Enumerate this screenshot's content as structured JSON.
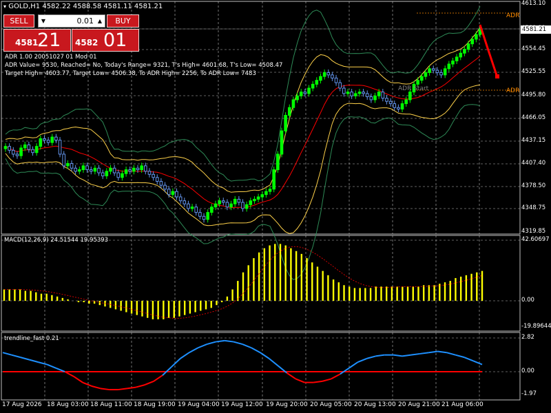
{
  "window": {
    "symbol_line": "GOLD,H1  4582.22 4588.58 4581.11 4581.21"
  },
  "trade_panel": {
    "sell_label": "SELL",
    "buy_label": "BUY",
    "lot": "0.01",
    "sell_price_small": "4581",
    "sell_price_big": "21",
    "buy_price_small": "4582",
    "buy_price_big": "01"
  },
  "adr": {
    "line1": "ADR 1.00 20051027 01 Mod 01",
    "line2": "ADR Value= 9530, Reached= No, Today's Range= 9321, T's High= 4601.68, T's Low= 4508.47",
    "line3": "Target High= 4603.77, Target Low= 4506.38, To ADR High= 2256, To ADR Low= 7483",
    "adr_label_top": "ADR",
    "adr_label_bottom": "ADR",
    "adr_start": "ADR Start"
  },
  "price_axis": {
    "ticks": [
      "4613.10",
      "4581.21",
      "4554.45",
      "4525.55",
      "4495.80",
      "4466.05",
      "4437.15",
      "4407.40",
      "4378.50",
      "4348.75",
      "4319.85"
    ],
    "current_price": "4581.21"
  },
  "macd": {
    "label": "MACD(12,26,9) 24.51544 19.95393",
    "ticks": [
      "42.60697",
      "0.00",
      "-19.89644"
    ]
  },
  "trendline": {
    "label": "trendline_fast 0.21",
    "ticks": [
      "2.82",
      "0.00",
      "-1.97"
    ]
  },
  "time_axis": {
    "labels": [
      "17 Aug 2026",
      "18 Aug 03:00",
      "18 Aug 11:00",
      "18 Aug 19:00",
      "19 Aug 04:00",
      "19 Aug 12:00",
      "19 Aug 20:00",
      "20 Aug 05:00",
      "20 Aug 13:00",
      "20 Aug 21:00",
      "21 Aug 06:00"
    ]
  },
  "chart_data": {
    "type": "candlestick",
    "colors": {
      "bull": "#00ff00",
      "bear": "#6495ed",
      "grid": "#c0c0c0",
      "bollinger_outer": "#2e8b57",
      "bollinger_inner": "#ffd24a",
      "ma": "#ff0000",
      "macd_hist": "#ffff00",
      "macd_signal": "#ff0000",
      "trend_fast": "#1e90ff",
      "trend_zero": "#ff0000",
      "adr": "#ff8c00"
    },
    "price_min": 4319.85,
    "price_max": 4613.1,
    "closes": [
      4430,
      4425,
      4420,
      4418,
      4428,
      4432,
      4426,
      4422,
      4430,
      4440,
      4438,
      4435,
      4442,
      4438,
      4420,
      4405,
      4408,
      4402,
      4398,
      4400,
      4405,
      4400,
      4398,
      4402,
      4396,
      4392,
      4398,
      4402,
      4396,
      4390,
      4395,
      4400,
      4398,
      4402,
      4400,
      4405,
      4398,
      4394,
      4390,
      4385,
      4380,
      4375,
      4368,
      4372,
      4365,
      4360,
      4356,
      4350,
      4352,
      4345,
      4340,
      4336,
      4345,
      4352,
      4356,
      4360,
      4358,
      4352,
      4356,
      4362,
      4358,
      4350,
      4355,
      4360,
      4362,
      4365,
      4368,
      4372,
      4375,
      4400,
      4420,
      4450,
      4470,
      4480,
      4490,
      4495,
      4500,
      4498,
      4505,
      4510,
      4515,
      4520,
      4525,
      4522,
      4518,
      4512,
      4505,
      4498,
      4500,
      4495,
      4498,
      4500,
      4498,
      4494,
      4490,
      4495,
      4500,
      4492,
      4488,
      4485,
      4480,
      4478,
      4485,
      4490,
      4500,
      4510,
      4515,
      4520,
      4525,
      4530,
      4528,
      4525,
      4522,
      4530,
      4536,
      4540,
      4545,
      4550,
      4555,
      4562,
      4568,
      4574,
      4581
    ],
    "macd_values": [
      8,
      8,
      8,
      8,
      7,
      7,
      6,
      5,
      5,
      4,
      3,
      2,
      1,
      0,
      -1,
      -1,
      -2,
      -2,
      -3,
      -4,
      -5,
      -6,
      -7,
      -8,
      -9,
      -10,
      -11,
      -12,
      -13,
      -13,
      -13,
      -12,
      -12,
      -11,
      -10,
      -9,
      -8,
      -7,
      -6,
      -5,
      -3,
      -1,
      3,
      8,
      14,
      20,
      25,
      30,
      34,
      37,
      39,
      40,
      40,
      39,
      37,
      35,
      33,
      30,
      27,
      24,
      21,
      18,
      15,
      13,
      11,
      10,
      9,
      9,
      9,
      9,
      10,
      10,
      10,
      10,
      10,
      10,
      10,
      10,
      10,
      11,
      11,
      11,
      12,
      13,
      14,
      16,
      17,
      18,
      19,
      20,
      21
    ],
    "trend_values": [
      1.6,
      1.4,
      1.2,
      1.0,
      0.8,
      0.6,
      0.3,
      0.0,
      -0.4,
      -0.9,
      -1.2,
      -1.4,
      -1.5,
      -1.5,
      -1.4,
      -1.3,
      -1.1,
      -0.8,
      -0.3,
      0.4,
      1.1,
      1.6,
      2.0,
      2.3,
      2.5,
      2.6,
      2.5,
      2.3,
      2.0,
      1.6,
      1.1,
      0.5,
      -0.1,
      -0.6,
      -0.9,
      -0.9,
      -0.8,
      -0.6,
      -0.2,
      0.3,
      0.8,
      1.1,
      1.3,
      1.4,
      1.4,
      1.3,
      1.4,
      1.5,
      1.6,
      1.7,
      1.6,
      1.4,
      1.2,
      0.9,
      0.6
    ]
  }
}
